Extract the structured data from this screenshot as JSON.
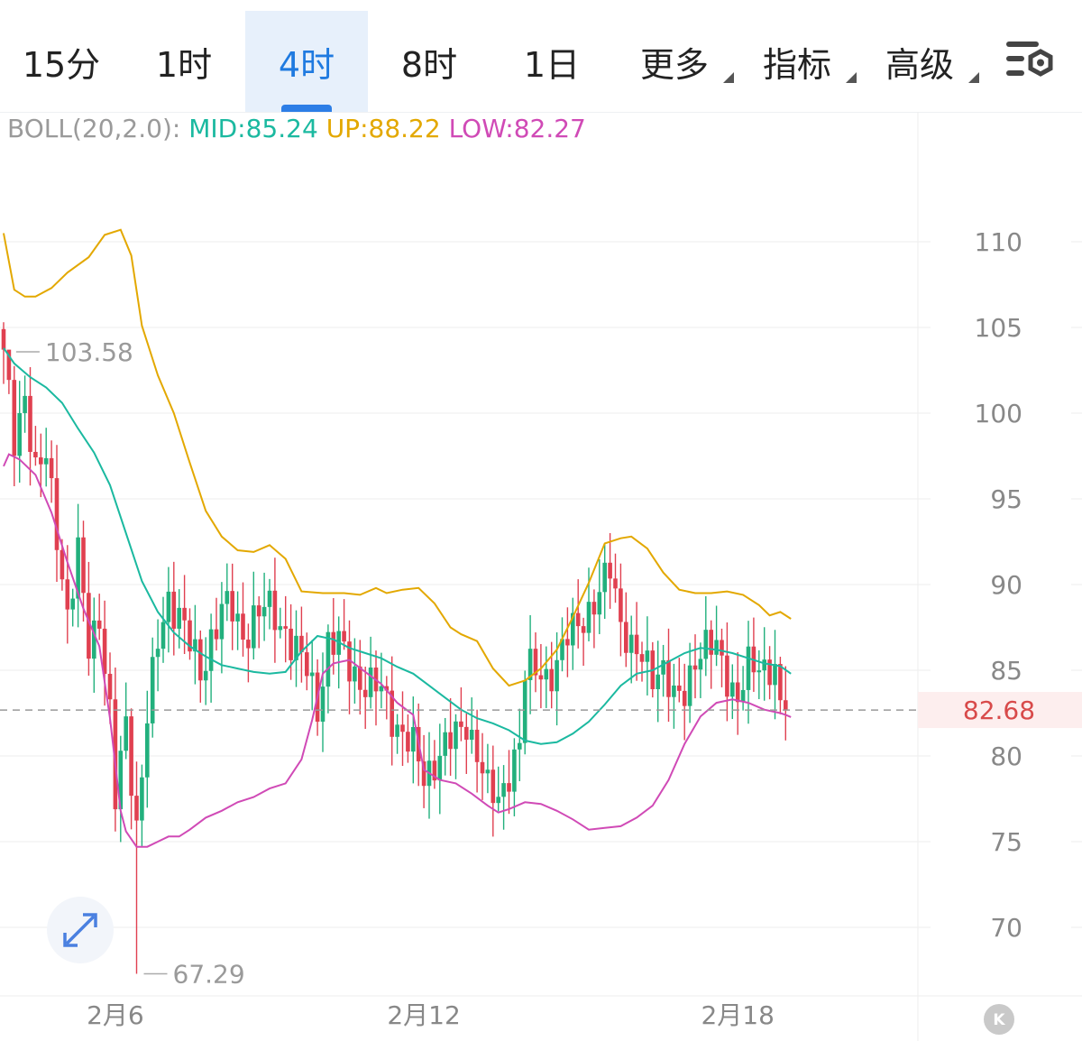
{
  "toolbar": {
    "tabs": [
      {
        "label": "15分",
        "active": false
      },
      {
        "label": "1时",
        "active": false
      },
      {
        "label": "4时",
        "active": true
      },
      {
        "label": "8时",
        "active": false
      },
      {
        "label": "1日",
        "active": false
      }
    ],
    "dropdowns": [
      {
        "label": "更多"
      },
      {
        "label": "指标"
      },
      {
        "label": "高级"
      }
    ],
    "settings_icon": "chart-settings-icon"
  },
  "indicator": {
    "label": "BOLL(20,2.0):",
    "mid": "MID:85.24",
    "up": "UP:88.22",
    "low": "LOW:82.27"
  },
  "controls": {
    "expand_icon": "expand-arrows-icon",
    "k_label": "K"
  },
  "colors": {
    "up_candle": "#22b07d",
    "down_candle": "#e04050",
    "mid_line": "#1bb9a0",
    "upper_line": "#e3a800",
    "lower_line": "#d04ab6",
    "grid": "#eeeeee",
    "last_price": "#d84a4a",
    "axis_text": "#888888"
  },
  "chart_data": {
    "type": "candlestick",
    "y_ticks": [
      110,
      105,
      100,
      95,
      90,
      85,
      80,
      75,
      70
    ],
    "ylim": [
      66,
      116
    ],
    "x_labels": [
      {
        "label": "2月6",
        "index": 21
      },
      {
        "label": "2月12",
        "index": 79
      },
      {
        "label": "2月18",
        "index": 138
      }
    ],
    "candle_count": 148,
    "last_price": {
      "value": 82.68,
      "label": "82.68"
    },
    "annotations": [
      {
        "label": "103.58",
        "value": 103.58,
        "index": 1
      },
      {
        "label": "67.29",
        "value": 67.29,
        "index": 25
      }
    ],
    "keypoints": [
      [
        0,
        103.2
      ],
      [
        2,
        98.2
      ],
      [
        4,
        101.4
      ],
      [
        6,
        96.5
      ],
      [
        8,
        97.2
      ],
      [
        10,
        93.1
      ],
      [
        12,
        88.4
      ],
      [
        14,
        91.6
      ],
      [
        16,
        86.2
      ],
      [
        18,
        88.5
      ],
      [
        20,
        82.4
      ],
      [
        21,
        77.2
      ],
      [
        23,
        81.7
      ],
      [
        25,
        76.1
      ],
      [
        27,
        82.4
      ],
      [
        29,
        86.3
      ],
      [
        31,
        89.2
      ],
      [
        33,
        88.6
      ],
      [
        35,
        86.4
      ],
      [
        37,
        84.5
      ],
      [
        39,
        87.1
      ],
      [
        41,
        88.7
      ],
      [
        43,
        88.2
      ],
      [
        45,
        87.0
      ],
      [
        47,
        88.3
      ],
      [
        49,
        88.5
      ],
      [
        51,
        88.0
      ],
      [
        53,
        87.5
      ],
      [
        55,
        86.2
      ],
      [
        57,
        84.8
      ],
      [
        59,
        82.9
      ],
      [
        61,
        86.8
      ],
      [
        63,
        86.4
      ],
      [
        65,
        85.1
      ],
      [
        67,
        84.6
      ],
      [
        69,
        84.1
      ],
      [
        71,
        83.6
      ],
      [
        73,
        82.4
      ],
      [
        75,
        81.5
      ],
      [
        77,
        80.3
      ],
      [
        79,
        78.6
      ],
      [
        81,
        79.9
      ],
      [
        83,
        80.6
      ],
      [
        85,
        80.9
      ],
      [
        87,
        82.1
      ],
      [
        89,
        80.4
      ],
      [
        91,
        77.8
      ],
      [
        93,
        77.3
      ],
      [
        95,
        79.4
      ],
      [
        97,
        80.6
      ],
      [
        98,
        84.5
      ],
      [
        100,
        85.2
      ],
      [
        102,
        84.9
      ],
      [
        104,
        85.0
      ],
      [
        106,
        86.8
      ],
      [
        108,
        88.2
      ],
      [
        110,
        88.4
      ],
      [
        112,
        89.0
      ],
      [
        114,
        91.2
      ],
      [
        116,
        88.2
      ],
      [
        118,
        86.0
      ],
      [
        120,
        85.4
      ],
      [
        122,
        85.1
      ],
      [
        124,
        85.3
      ],
      [
        126,
        82.9
      ],
      [
        128,
        83.6
      ],
      [
        130,
        86.1
      ],
      [
        132,
        86.3
      ],
      [
        134,
        86.0
      ],
      [
        136,
        84.8
      ],
      [
        138,
        83.5
      ],
      [
        140,
        84.9
      ],
      [
        142,
        85.1
      ],
      [
        144,
        85.6
      ],
      [
        145,
        85.2
      ],
      [
        146,
        82.68
      ]
    ],
    "bollinger": {
      "upper": [
        [
          0,
          110.5
        ],
        [
          2,
          107.2
        ],
        [
          4,
          106.8
        ],
        [
          6,
          106.8
        ],
        [
          9,
          107.3
        ],
        [
          12,
          108.2
        ],
        [
          16,
          109.1
        ],
        [
          19,
          110.4
        ],
        [
          22,
          110.7
        ],
        [
          24,
          109.2
        ],
        [
          26,
          105.1
        ],
        [
          29,
          102.2
        ],
        [
          32,
          100.0
        ],
        [
          35,
          97.1
        ],
        [
          38,
          94.3
        ],
        [
          41,
          92.8
        ],
        [
          44,
          92.0
        ],
        [
          47,
          91.9
        ],
        [
          50,
          92.3
        ],
        [
          53,
          91.5
        ],
        [
          56,
          89.6
        ],
        [
          60,
          89.5
        ],
        [
          64,
          89.5
        ],
        [
          67,
          89.4
        ],
        [
          70,
          89.8
        ],
        [
          72,
          89.5
        ],
        [
          75,
          89.7
        ],
        [
          78,
          89.8
        ],
        [
          81,
          88.9
        ],
        [
          84,
          87.5
        ],
        [
          86,
          87.1
        ],
        [
          89,
          86.7
        ],
        [
          92,
          85.1
        ],
        [
          95,
          84.1
        ],
        [
          98,
          84.4
        ],
        [
          101,
          85.1
        ],
        [
          104,
          86.2
        ],
        [
          107,
          88.1
        ],
        [
          110,
          90.1
        ],
        [
          113,
          92.4
        ],
        [
          116,
          92.7
        ],
        [
          118,
          92.8
        ],
        [
          121,
          92.1
        ],
        [
          124,
          90.7
        ],
        [
          127,
          89.7
        ],
        [
          130,
          89.5
        ],
        [
          133,
          89.5
        ],
        [
          136,
          89.6
        ],
        [
          139,
          89.4
        ],
        [
          142,
          88.8
        ],
        [
          144,
          88.2
        ],
        [
          146,
          88.4
        ],
        [
          148,
          88.0
        ]
      ],
      "mid": [
        [
          0,
          103.8
        ],
        [
          2,
          102.9
        ],
        [
          5,
          102.1
        ],
        [
          8,
          101.5
        ],
        [
          11,
          100.6
        ],
        [
          14,
          99.1
        ],
        [
          17,
          97.7
        ],
        [
          20,
          95.8
        ],
        [
          23,
          93.0
        ],
        [
          26,
          90.2
        ],
        [
          29,
          88.4
        ],
        [
          32,
          87.2
        ],
        [
          35,
          86.4
        ],
        [
          38,
          85.8
        ],
        [
          41,
          85.3
        ],
        [
          44,
          85.1
        ],
        [
          47,
          84.9
        ],
        [
          50,
          84.8
        ],
        [
          53,
          84.9
        ],
        [
          56,
          86.1
        ],
        [
          59,
          87.0
        ],
        [
          62,
          86.8
        ],
        [
          65,
          86.3
        ],
        [
          68,
          86.0
        ],
        [
          71,
          85.7
        ],
        [
          74,
          85.2
        ],
        [
          77,
          84.8
        ],
        [
          80,
          84.1
        ],
        [
          83,
          83.4
        ],
        [
          86,
          82.7
        ],
        [
          89,
          82.2
        ],
        [
          92,
          81.9
        ],
        [
          95,
          81.5
        ],
        [
          98,
          80.9
        ],
        [
          101,
          80.7
        ],
        [
          104,
          80.8
        ],
        [
          107,
          81.3
        ],
        [
          110,
          82.0
        ],
        [
          113,
          83.0
        ],
        [
          116,
          84.1
        ],
        [
          119,
          84.8
        ],
        [
          122,
          85.0
        ],
        [
          125,
          85.5
        ],
        [
          128,
          86.0
        ],
        [
          131,
          86.3
        ],
        [
          134,
          86.2
        ],
        [
          137,
          86.0
        ],
        [
          140,
          85.7
        ],
        [
          143,
          85.4
        ],
        [
          146,
          85.24
        ],
        [
          148,
          84.8
        ]
      ],
      "lower": [
        [
          0,
          96.9
        ],
        [
          1,
          97.6
        ],
        [
          3,
          97.3
        ],
        [
          6,
          96.4
        ],
        [
          9,
          94.2
        ],
        [
          12,
          91.3
        ],
        [
          15,
          88.6
        ],
        [
          18,
          86.4
        ],
        [
          20,
          82.2
        ],
        [
          22,
          76.8
        ],
        [
          23,
          75.6
        ],
        [
          25,
          74.7
        ],
        [
          27,
          74.7
        ],
        [
          29,
          75.0
        ],
        [
          31,
          75.3
        ],
        [
          33,
          75.3
        ],
        [
          35,
          75.7
        ],
        [
          38,
          76.4
        ],
        [
          41,
          76.8
        ],
        [
          44,
          77.3
        ],
        [
          47,
          77.6
        ],
        [
          50,
          78.1
        ],
        [
          53,
          78.4
        ],
        [
          56,
          79.8
        ],
        [
          58,
          82.1
        ],
        [
          60,
          84.8
        ],
        [
          62,
          85.4
        ],
        [
          65,
          85.6
        ],
        [
          68,
          84.9
        ],
        [
          71,
          84.2
        ],
        [
          74,
          83.1
        ],
        [
          77,
          82.4
        ],
        [
          79,
          79.2
        ],
        [
          82,
          78.6
        ],
        [
          85,
          78.4
        ],
        [
          88,
          77.8
        ],
        [
          91,
          77.1
        ],
        [
          93,
          76.7
        ],
        [
          95,
          76.9
        ],
        [
          98,
          77.3
        ],
        [
          101,
          77.2
        ],
        [
          104,
          76.8
        ],
        [
          107,
          76.3
        ],
        [
          110,
          75.7
        ],
        [
          113,
          75.8
        ],
        [
          116,
          75.9
        ],
        [
          119,
          76.4
        ],
        [
          122,
          77.1
        ],
        [
          125,
          78.6
        ],
        [
          128,
          80.7
        ],
        [
          131,
          82.3
        ],
        [
          134,
          83.1
        ],
        [
          137,
          83.3
        ],
        [
          140,
          83.1
        ],
        [
          143,
          82.7
        ],
        [
          146,
          82.5
        ],
        [
          147,
          82.4
        ],
        [
          148,
          82.27
        ]
      ]
    }
  }
}
